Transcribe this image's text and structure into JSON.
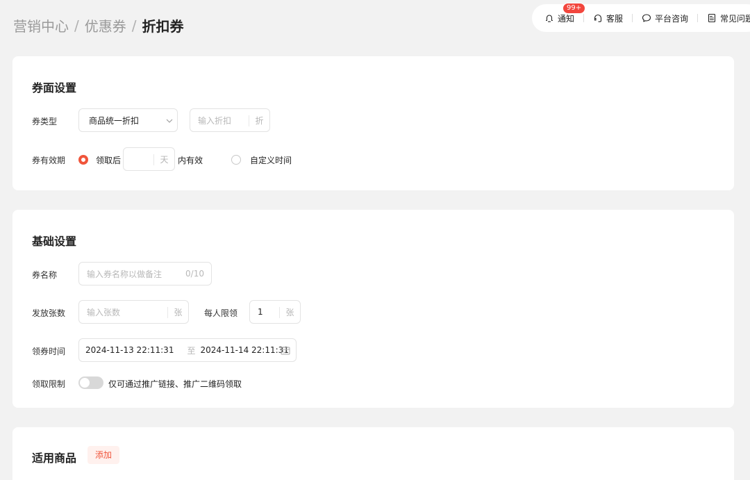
{
  "breadcrumb": {
    "items": [
      "营销中心",
      "优惠券"
    ],
    "separator": "/",
    "current": "折扣券"
  },
  "topbar": {
    "notify": {
      "label": "通知",
      "badge": "99+"
    },
    "service": {
      "label": "客服"
    },
    "consult": {
      "label": "平台咨询"
    },
    "faq": {
      "label": "常见问题"
    }
  },
  "coupon_face": {
    "title": "券面设置",
    "type_label": "券类型",
    "type_value": "商品统一折扣",
    "discount_placeholder": "输入折扣",
    "discount_unit": "折",
    "validity_label": "券有效期",
    "option_after_claim": "领取后",
    "days_unit": "天",
    "option_after_suffix": "内有效",
    "option_custom": "自定义时间"
  },
  "basic": {
    "title": "基础设置",
    "name_label": "券名称",
    "name_placeholder": "输入券名称以做备注",
    "name_counter": "0/10",
    "count_label": "发放张数",
    "count_placeholder": "输入张数",
    "count_unit": "张",
    "limit_label": "每人限领",
    "limit_value": "1",
    "limit_unit": "张",
    "time_label": "领券时间",
    "start_time": "2024-11-13 22:11:31",
    "time_sep": "至",
    "end_time": "2024-11-14 22:11:31",
    "restrict_label": "领取限制",
    "restrict_text": "仅可通过推广链接、推广二维码领取"
  },
  "products": {
    "title": "适用商品",
    "add_label": "添加"
  },
  "colors": {
    "accent": "#f0553b",
    "badge": "#f2463d",
    "background": "#f2f2f2"
  }
}
